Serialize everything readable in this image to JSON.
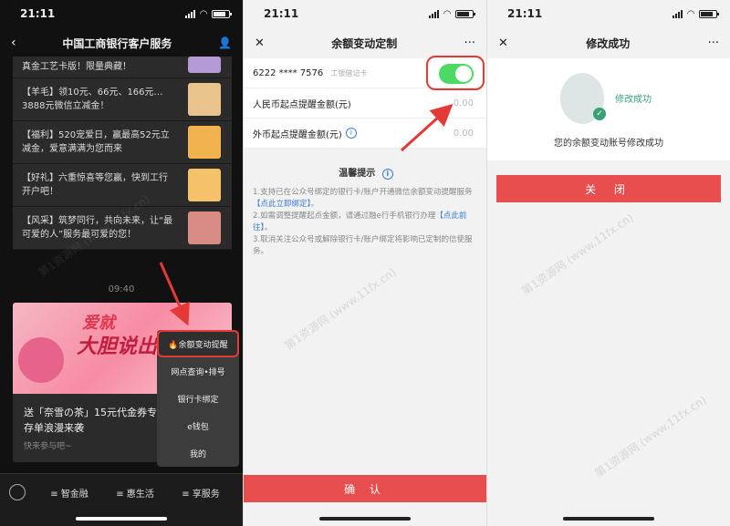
{
  "status_bar": {
    "time": "21:11"
  },
  "panel1": {
    "nav_title": "中国工商银行客户服务",
    "messages": [
      {
        "text": "真金工艺卡版！限量典藏！"
      },
      {
        "text": "【羊毛】领10元、66元、166元…3888元微信立减金！"
      },
      {
        "text": "【福利】520宠爱日，赢最高52元立减金，爱意满满为您而来"
      },
      {
        "text": "【好礼】六重惊喜等您赢，快到工行开户吧！"
      },
      {
        "text": "【风采】筑梦同行，共向未来，让“最可爱的人”服务最可爱的您！"
      }
    ],
    "time_label": "09:40",
    "card": {
      "banner_line1": "爱就",
      "banner_line2": "大胆说出来",
      "text": "送「奈雪の茶」15元代金券专属定制卡片、存单浪漫来袭",
      "sub": "快来参与吧~"
    },
    "popup_menu": [
      {
        "label": "🔥余额变动提醒",
        "highlight": true
      },
      {
        "label": "网点查询•排号"
      },
      {
        "label": "银行卡绑定"
      },
      {
        "label": "e钱包"
      },
      {
        "label": "我的"
      }
    ],
    "bottom_tabs": [
      "智金融",
      "惠生活",
      "享服务"
    ]
  },
  "panel2": {
    "nav_title": "余额变动定制",
    "card_number": "6222 **** 7576",
    "card_type": "工银借记卡",
    "toggle_on": true,
    "rmb_label": "人民币起点提醒金额(元)",
    "rmb_value": "0.00",
    "fx_label": "外币起点提醒金额(元)",
    "fx_value": "0.00",
    "tips_title": "温馨提示",
    "tips": {
      "t1a": "1.支持已在公众号绑定的银行卡/账户开通微信余额变动提醒服务",
      "t1link": "【点此立即绑定】",
      "t1b": "。",
      "t2a": "2.如需调整提醒起点金额，请通过融e行手机银行办理",
      "t2link": "【点此前往】",
      "t2b": "。",
      "t3": "3.取消关注公众号或解除银行卡/账户绑定将影响已定制的信使服务。"
    },
    "confirm_label": "确 认"
  },
  "panel3": {
    "nav_title": "修改成功",
    "success_title": "修改成功",
    "success_desc": "您的余额变动账号修改成功",
    "close_label": "关 闭"
  },
  "watermark": "第1资源网 (www.11fx.cn)",
  "colors": {
    "accent_red": "#e84e4e",
    "toggle_green": "#4cd964",
    "link_blue": "#3a7bd5",
    "success_green": "#3aa176"
  }
}
